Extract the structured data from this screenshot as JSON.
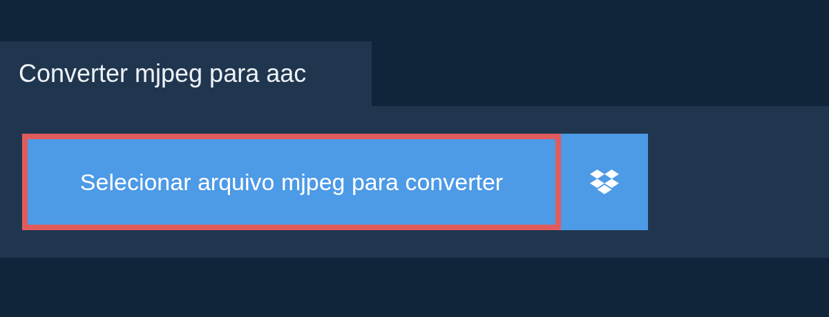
{
  "tab": {
    "title": "Converter mjpeg para aac"
  },
  "select_button": {
    "label": "Selecionar arquivo mjpeg para converter",
    "focused": true
  }
}
